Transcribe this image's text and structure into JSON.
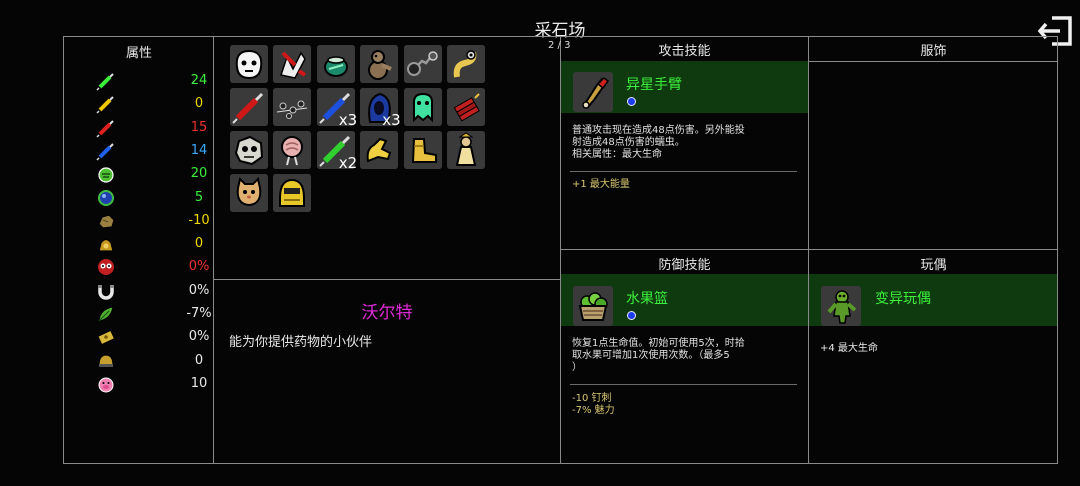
{
  "header": {
    "title": "采石场"
  },
  "attributes": {
    "heading": "属性",
    "stats": [
      {
        "icon": "green-syringe-icon",
        "value": "24",
        "color": "#3cf03c"
      },
      {
        "icon": "yellow-syringe-icon",
        "value": "0",
        "color": "#f0d800"
      },
      {
        "icon": "red-syringe-icon",
        "value": "15",
        "color": "#f03030"
      },
      {
        "icon": "blue-syringe-icon",
        "value": "14",
        "color": "#39a9ff"
      },
      {
        "icon": "green-hand-icon",
        "value": "20",
        "color": "#3cf03c"
      },
      {
        "icon": "blue-orb-icon",
        "value": "5",
        "color": "#3cf03c"
      },
      {
        "icon": "rock-icon",
        "value": "-10",
        "color": "#f0d800"
      },
      {
        "icon": "gold-bag-icon",
        "value": "0",
        "color": "#f0d800"
      },
      {
        "icon": "red-eyes-icon",
        "value": "0%",
        "color": "#f03030"
      },
      {
        "icon": "magnet-icon",
        "value": "0%",
        "color": "#e8e8e8"
      },
      {
        "icon": "leaf-icon",
        "value": "-7%",
        "color": "#e8e8e8"
      },
      {
        "icon": "ticket-icon",
        "value": "0%",
        "color": "#e8e8e8"
      },
      {
        "icon": "helmet-icon",
        "value": "0",
        "color": "#e8e8e8"
      },
      {
        "icon": "pink-pig-icon",
        "value": "10",
        "color": "#e8e8e8"
      }
    ]
  },
  "items": [
    {
      "name": "white-mask-item",
      "count": ""
    },
    {
      "name": "bloody-hand-item",
      "count": ""
    },
    {
      "name": "green-pot-item",
      "count": ""
    },
    {
      "name": "teddy-creature-item",
      "count": ""
    },
    {
      "name": "chain-flail-item",
      "count": ""
    },
    {
      "name": "goggle-worm-item",
      "count": ""
    },
    {
      "name": "red-syringe-item",
      "count": ""
    },
    {
      "name": "bug-swarm-item",
      "count": ""
    },
    {
      "name": "blue-syringe-item",
      "count": "x3"
    },
    {
      "name": "blue-hood-item",
      "count": "x3"
    },
    {
      "name": "green-ghost-item",
      "count": ""
    },
    {
      "name": "dynamite-item",
      "count": ""
    },
    {
      "name": "skull-stone-item",
      "count": ""
    },
    {
      "name": "pink-brain-item",
      "count": ""
    },
    {
      "name": "green-syringe-item",
      "count": "x2"
    },
    {
      "name": "yellow-arm-item",
      "count": ""
    },
    {
      "name": "gold-boot-item",
      "count": ""
    },
    {
      "name": "robed-figure-item",
      "count": ""
    },
    {
      "name": "cat-head-item",
      "count": ""
    },
    {
      "name": "yellow-helmet-item",
      "count": ""
    }
  ],
  "character": {
    "name": "沃尔特",
    "description": "能为你提供药物的小伙伴",
    "page": "2 / 3"
  },
  "attack": {
    "heading": "攻击技能",
    "name": "异星手臂",
    "desc": [
      "普通攻击现在造成48点伤害。另外能投",
      "射造成48点伤害的蠕虫。",
      "相关属性：最大生命"
    ],
    "bonuses": [
      "+1 最大能量"
    ]
  },
  "outfit": {
    "heading": "服饰"
  },
  "defense": {
    "heading": "防御技能",
    "name": "水果篮",
    "desc": [
      "恢复1点生命值。初始可使用5次，时拾",
      "取水果可增加1次使用次数。（最多5",
      "）"
    ],
    "bonuses": [
      "-10 钉刺",
      "-7% 魅力"
    ]
  },
  "doll": {
    "heading": "玩偶",
    "name": "变异玩偶",
    "bonuses": [
      "+4 最大生命"
    ]
  },
  "colors": {
    "accent_green": "#3cf03c",
    "band": "#0f3a0f",
    "name_magenta": "#e02ad8",
    "bonus_gold": "#d8c870"
  }
}
